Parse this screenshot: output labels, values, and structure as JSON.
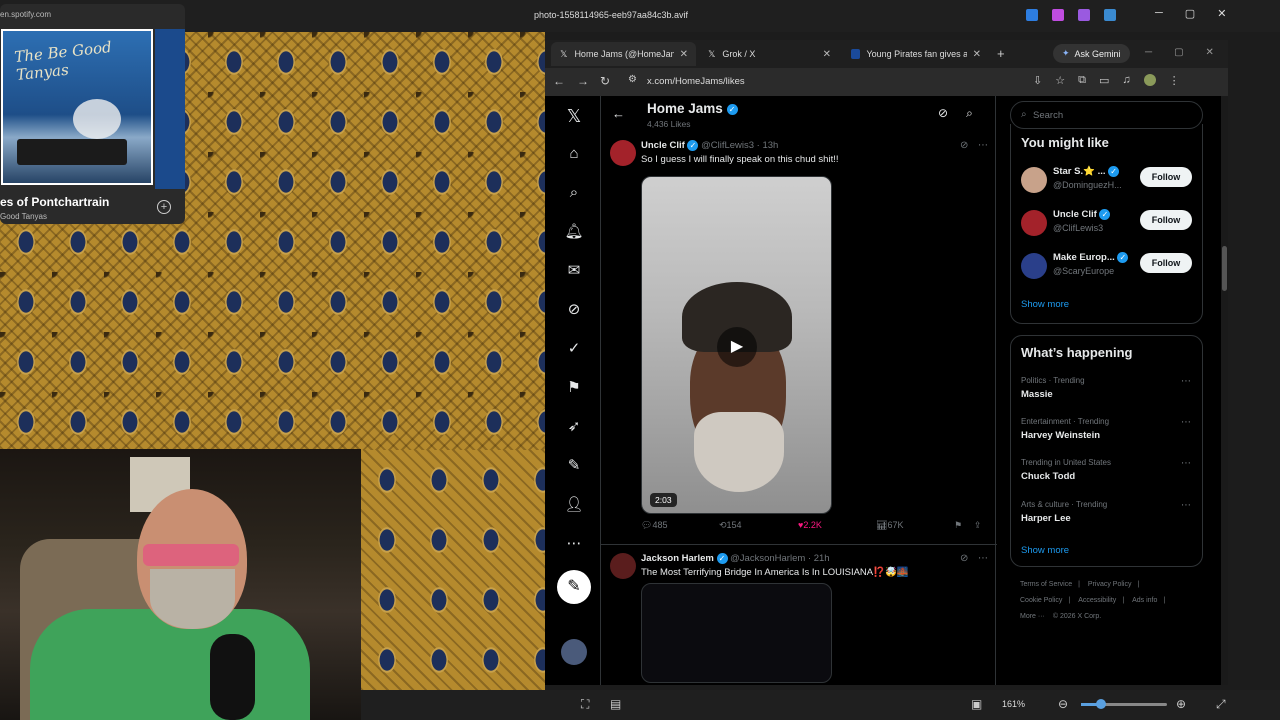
{
  "viewer": {
    "title": "photo-1558114965-eeb97aa84c3b.avif",
    "zoom": "161%",
    "accent": "#5aa0e0"
  },
  "spotify": {
    "url": "en.spotify.com",
    "album_text": "The Be Good Tanyas",
    "song": "es of Pontchartrain",
    "artist": "Good Tanyas"
  },
  "browser": {
    "tabs": [
      {
        "label": "Home Jams (@HomeJams) /",
        "icon": "x-logo-icon"
      },
      {
        "label": "Grok / X",
        "icon": "x-logo-icon"
      },
      {
        "label": "Young Pirates fan gives awa",
        "icon": "mlb-icon"
      }
    ],
    "gemini_label": "Ask Gemini",
    "url": "x.com/HomeJams/likes"
  },
  "x": {
    "profile_name": "Home Jams",
    "likes_count": "4,436 Likes",
    "tweets": [
      {
        "display_name": "Uncle Clif",
        "handle": "@ClifLewis3",
        "time": "· 13h",
        "text": "So I guess I will finally speak on this chud shit!!",
        "duration": "2:03",
        "replies": "485",
        "reposts": "154",
        "likes": "2.2K",
        "views": "67K"
      },
      {
        "display_name": "Jackson Harlem",
        "handle": "@JacksonHarlem",
        "time": "· 21h",
        "text": "The Most Terrifying Bridge In America Is In LOUISIANA⁉️🤯🌉"
      }
    ],
    "search_placeholder": "Search",
    "you_might_like": {
      "title": "You might like",
      "accounts": [
        {
          "name": "Star S.⭐ ...",
          "handle": "@DominguezH...",
          "follow": "Follow"
        },
        {
          "name": "Uncle Clif",
          "handle": "@ClifLewis3",
          "follow": "Follow"
        },
        {
          "name": "Make Europ...",
          "handle": "@ScaryEurope",
          "follow": "Follow"
        }
      ],
      "show_more": "Show more"
    },
    "whats_happening": {
      "title": "What’s happening",
      "trends": [
        {
          "context": "Politics · Trending",
          "topic": "Massie"
        },
        {
          "context": "Entertainment · Trending",
          "topic": "Harvey Weinstein"
        },
        {
          "context": "Trending in United States",
          "topic": "Chuck Todd"
        },
        {
          "context": "Arts & culture · Trending",
          "topic": "Harper Lee"
        }
      ],
      "show_more": "Show more"
    },
    "footer": {
      "links": [
        "Terms of Service",
        "Privacy Policy",
        "Cookie Policy",
        "Accessibility",
        "Ads info",
        "More ···"
      ],
      "copyright": "© 2026 X Corp."
    },
    "like_color": "#f91880",
    "link_color": "#1d9bf0"
  }
}
